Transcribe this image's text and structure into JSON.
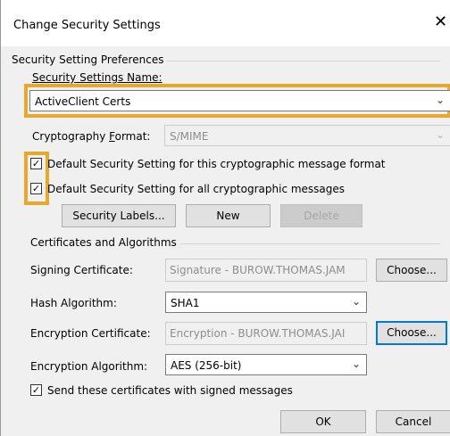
{
  "dialog": {
    "title": "Change Security Settings",
    "close_glyph": "✕"
  },
  "prefs": {
    "group_title": "Security Setting Preferences",
    "name_label": "Security Settings Name:",
    "name_value": "ActiveClient Certs",
    "crypto_label": "Cryptography Format:",
    "crypto_value": "S/MIME",
    "default_format_label": "Default Security Setting for this cryptographic message format",
    "default_format_checked": true,
    "default_all_label": "Default Security Setting for all cryptographic messages",
    "default_all_checked": true,
    "security_labels_button": "Security Labels...",
    "new_button": "New",
    "delete_button": "Delete"
  },
  "certs": {
    "group_title": "Certificates and Algorithms",
    "signing_label": "Signing Certificate:",
    "signing_value": "Signature - BUROW.THOMAS.JAM",
    "signing_choose": "Choose...",
    "hash_label": "Hash Algorithm:",
    "hash_value": "SHA1",
    "encryption_label": "Encryption Certificate:",
    "encryption_value": "Encryption - BUROW.THOMAS.JAI",
    "encryption_choose": "Choose...",
    "enc_alg_label": "Encryption Algorithm:",
    "enc_alg_value": "AES (256-bit)",
    "send_certs_label": "Send these certificates with signed messages",
    "send_certs_checked": true
  },
  "footer": {
    "ok": "OK",
    "cancel": "Cancel"
  },
  "colors": {
    "highlight": "#e6a82d",
    "focus": "#0078d7"
  },
  "icons": {
    "close": "close-icon",
    "dropdown": "chevron-down-icon",
    "check": "checkmark-icon"
  }
}
